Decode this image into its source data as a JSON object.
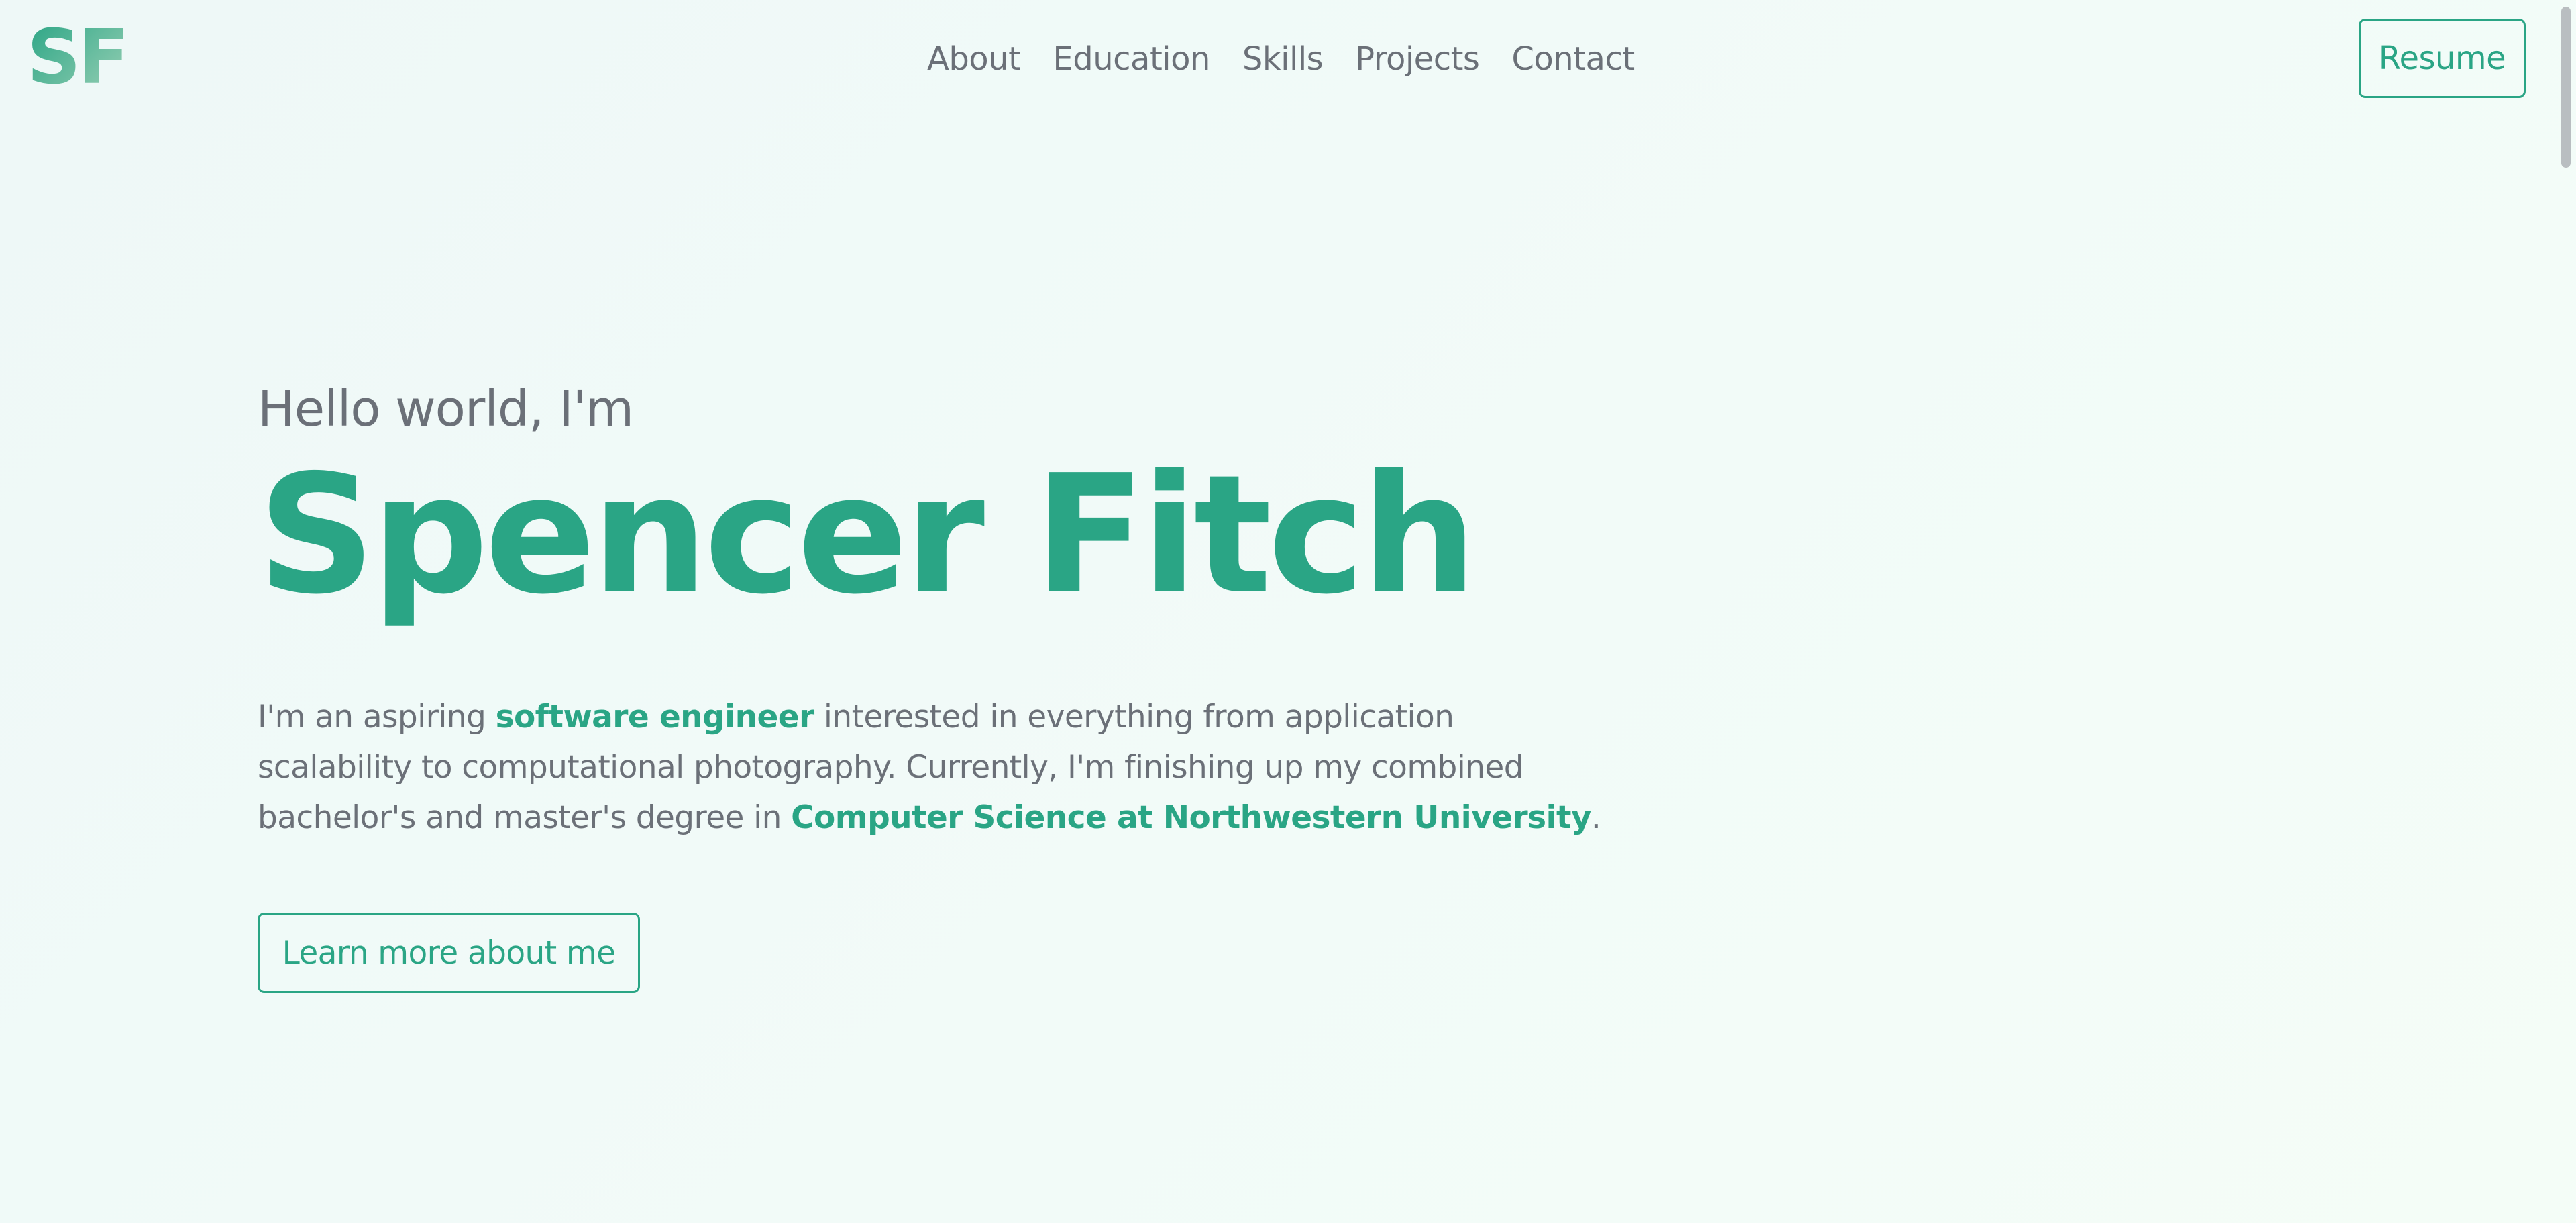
{
  "navbar": {
    "logo": "SF",
    "links": [
      {
        "label": "About"
      },
      {
        "label": "Education"
      },
      {
        "label": "Skills"
      },
      {
        "label": "Projects"
      },
      {
        "label": "Contact"
      }
    ],
    "resume_label": "Resume"
  },
  "hero": {
    "greeting": "Hello world, I'm",
    "name": "Spencer Fitch",
    "bio": {
      "part1": "I'm an aspiring ",
      "highlight1": "software engineer",
      "part2": " interested in everything from application scalability to computational photography. Currently, I'm finishing up my combined bachelor's and master's degree in ",
      "highlight2": "Computer Science at Northwestern University",
      "part3": "."
    },
    "cta_label": "Learn more about me"
  },
  "colors": {
    "accent": "#2aa585",
    "text_muted": "#6b7078",
    "background": "#eef8f7"
  }
}
